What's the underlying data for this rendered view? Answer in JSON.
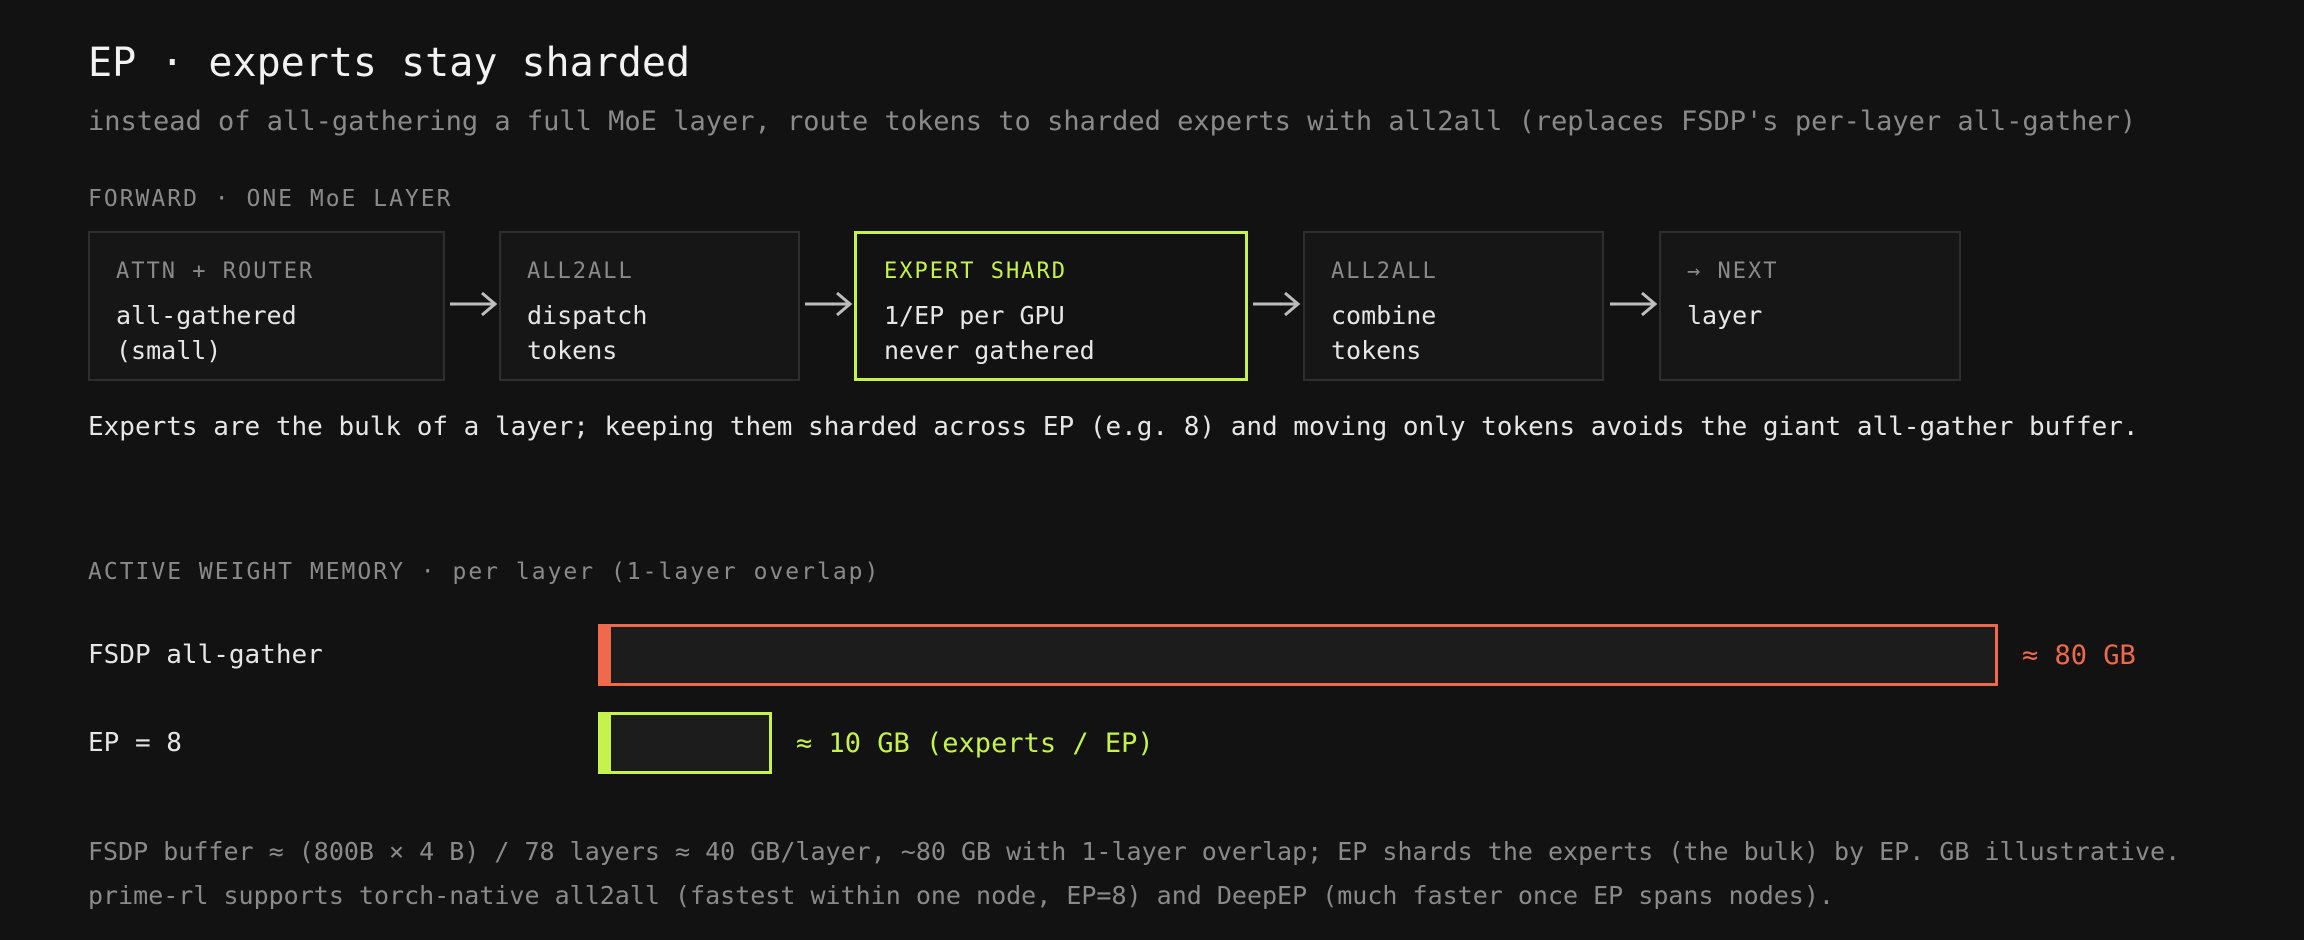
{
  "header": {
    "title": "EP · experts stay sharded",
    "subtitle": "instead of all-gathering a full MoE layer, route tokens to sharded experts with all2all (replaces FSDP's per-layer all-gather)"
  },
  "forward": {
    "label": "FORWARD · ONE MoE LAYER",
    "steps": [
      {
        "head": "ATTN + ROUTER",
        "body": "all-gathered\n(small)",
        "highlight": false
      },
      {
        "head": "ALL2ALL",
        "body": "dispatch\ntokens",
        "highlight": false
      },
      {
        "head": "EXPERT SHARD",
        "body": "1/EP per GPU\nnever gathered",
        "highlight": true
      },
      {
        "head": "ALL2ALL",
        "body": "combine\ntokens",
        "highlight": false
      },
      {
        "head": "→ NEXT",
        "body": "layer",
        "highlight": false
      }
    ],
    "explanation": "Experts are the bulk of a layer; keeping them sharded across EP (e.g. 8) and moving only tokens avoids the giant all-gather buffer."
  },
  "memory": {
    "label": "ACTIVE WEIGHT MEMORY · per layer (1-layer overlap)",
    "rows": [
      {
        "name": "FSDP all-gather",
        "value_gb": 80,
        "value_text": "≈ 80 GB",
        "color": "#ef6a4c"
      },
      {
        "name": "EP = 8",
        "value_gb": 10,
        "value_text": "≈ 10 GB (experts / EP)",
        "color": "#c6f24e"
      }
    ],
    "scale_max_gb": 80
  },
  "footer": {
    "line1": "FSDP buffer ≈ (800B × 4 B) / 78 layers ≈ 40 GB/layer, ~80 GB with 1-layer overlap; EP shards the experts (the bulk) by EP. GB illustrative.",
    "line2": "prime-rl supports torch-native all2all (fastest within one node, EP=8) and DeepEP (much faster once EP spans nodes)."
  },
  "colors": {
    "background": "#121212",
    "accent_green": "#c6f24e",
    "accent_orange": "#ef6a4c",
    "muted_text": "#8a8a8a"
  }
}
